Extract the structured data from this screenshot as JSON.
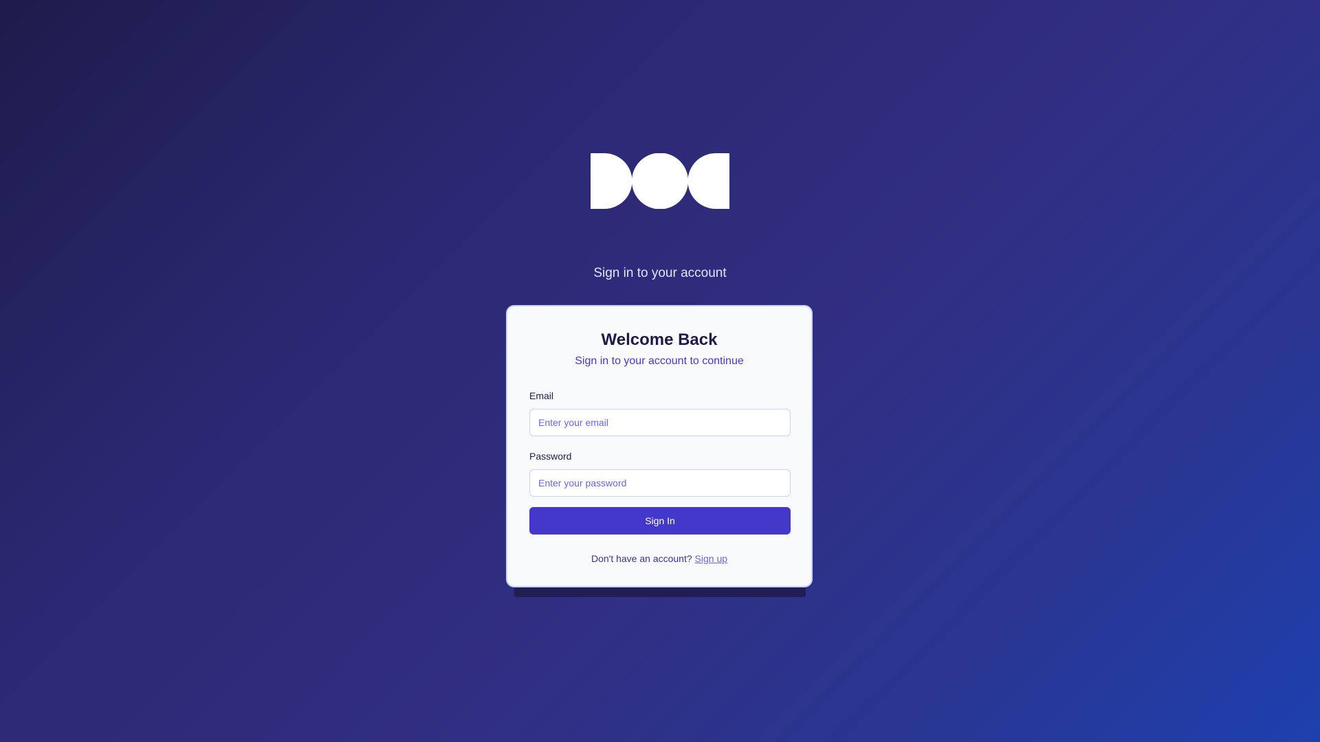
{
  "logo": {
    "icon": "three-shapes-logo-icon",
    "color": "#ffffff"
  },
  "header": {
    "tagline": "Sign in to your account"
  },
  "card": {
    "title": "Welcome Back",
    "subtitle": "Sign in to your account to continue",
    "email": {
      "label": "Email",
      "placeholder": "Enter your email",
      "value": ""
    },
    "password": {
      "label": "Password",
      "placeholder": "Enter your password",
      "value": ""
    },
    "submit_label": "Sign In",
    "footer": {
      "prompt": "Don't have an account? ",
      "link_label": "Sign up"
    }
  },
  "colors": {
    "background_start": "#1e1b4b",
    "background_end": "#1e40af",
    "accent": "#4338ca",
    "card_background": "#f8fafc",
    "placeholder": "#6366f1"
  }
}
